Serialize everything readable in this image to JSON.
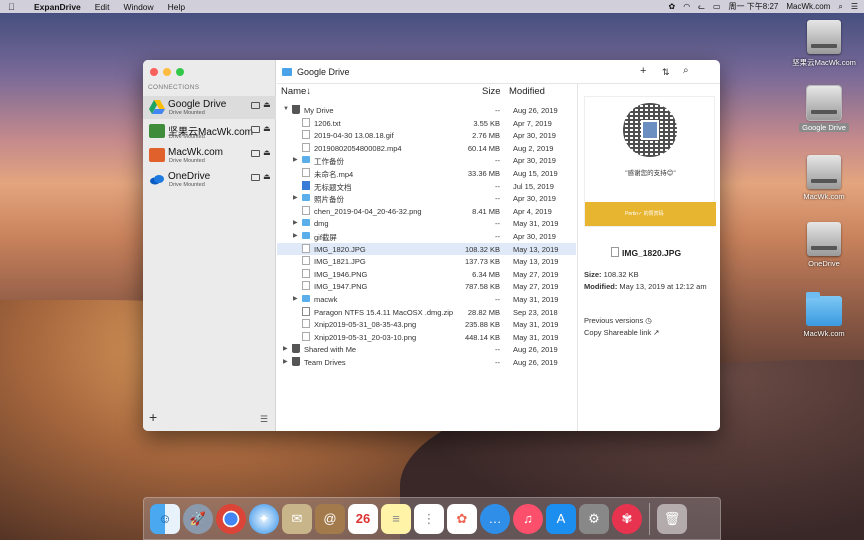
{
  "menubar": {
    "app": "ExpanDrive",
    "menus": [
      "Edit",
      "Window",
      "Help"
    ],
    "clock": "周一 下午8:27",
    "host": "MacWk.com"
  },
  "desktop": {
    "icons": [
      "坚果云MacWk.com",
      "Google Drive",
      "MacWk.com",
      "OneDrive",
      "MacWk.com"
    ]
  },
  "sidebar": {
    "heading": "CONNECTIONS",
    "connections": [
      {
        "name": "Google Drive",
        "status": "Drive Mounted"
      },
      {
        "name": "坚果云MacWk.com",
        "status": "Drive Mounted"
      },
      {
        "name": "MacWk.com",
        "status": "Drive Mounted"
      },
      {
        "name": "OneDrive",
        "status": "Drive Mounted"
      }
    ]
  },
  "toolbar": {
    "title": "Google Drive"
  },
  "columns": {
    "name": "Name↓",
    "size": "Size",
    "modified": "Modified"
  },
  "files": [
    {
      "name": "My Drive",
      "size": "--",
      "date": "Aug 26, 2019"
    },
    {
      "name": "1206.txt",
      "size": "3.55 KB",
      "date": "Apr 7, 2019"
    },
    {
      "name": "2019-04-30 13.08.18.gif",
      "size": "2.76 MB",
      "date": "Apr 30, 2019"
    },
    {
      "name": "20190802054800082.mp4",
      "size": "60.14 MB",
      "date": "Aug 2, 2019"
    },
    {
      "name": "工作备份",
      "size": "--",
      "date": "Apr 30, 2019"
    },
    {
      "name": "未命名.mp4",
      "size": "33.36 MB",
      "date": "Aug 15, 2019"
    },
    {
      "name": "无标题文档",
      "size": "--",
      "date": "Jul 15, 2019"
    },
    {
      "name": "照片备份",
      "size": "--",
      "date": "Apr 30, 2019"
    },
    {
      "name": "chen_2019-04-04_20-46-32.png",
      "size": "8.41 MB",
      "date": "Apr 4, 2019"
    },
    {
      "name": "dmg",
      "size": "--",
      "date": "May 31, 2019"
    },
    {
      "name": "gif截屏",
      "size": "--",
      "date": "Apr 30, 2019"
    },
    {
      "name": "IMG_1820.JPG",
      "size": "108.32 KB",
      "date": "May 13, 2019"
    },
    {
      "name": "IMG_1821.JPG",
      "size": "137.73 KB",
      "date": "May 13, 2019"
    },
    {
      "name": "IMG_1946.PNG",
      "size": "6.34 MB",
      "date": "May 27, 2019"
    },
    {
      "name": "IMG_1947.PNG",
      "size": "787.58 KB",
      "date": "May 27, 2019"
    },
    {
      "name": "macwk",
      "size": "--",
      "date": "May 31, 2019"
    },
    {
      "name": "Paragon NTFS 15.4.11 MacOSX .dmg.zip",
      "size": "28.82 MB",
      "date": "Sep 23, 2018"
    },
    {
      "name": "Xnip2019-05-31_08-35-43.png",
      "size": "235.88 KB",
      "date": "May 31, 2019"
    },
    {
      "name": "Xnip2019-05-31_20-03-10.png",
      "size": "448.14 KB",
      "date": "May 31, 2019"
    },
    {
      "name": "Shared with Me",
      "size": "--",
      "date": "Aug 26, 2019"
    },
    {
      "name": "Team Drives",
      "size": "--",
      "date": "Aug 26, 2019"
    }
  ],
  "preview": {
    "thanks": "\"感谢您的支持😊\"",
    "banner": "Pertin✓ 的赞赏码",
    "filename": "IMG_1820.JPG",
    "size_label": "Size:",
    "size_value": "108.32 KB",
    "modified_label": "Modified:",
    "modified_value": "May 13, 2019 at 12:12 am",
    "prev_versions": "Previous versions",
    "share_link": "Copy Shareable link"
  },
  "dock": {
    "calendar_day": "26"
  }
}
